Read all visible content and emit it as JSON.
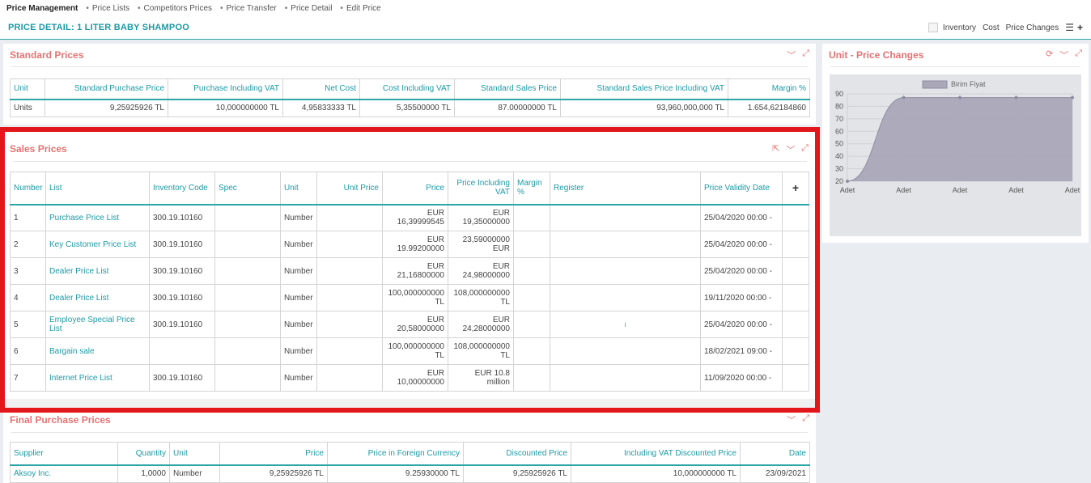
{
  "breadcrumb": {
    "active": "Price Management",
    "items": [
      "Price Lists",
      "Competitors Prices",
      "Price Transfer",
      "Price Detail",
      "Edit Price"
    ]
  },
  "header": {
    "title": "PRICE DETAIL: 1 LITER BABY SHAMPOO",
    "inventory": "Inventory",
    "cost": "Cost",
    "price_changes": "Price Changes"
  },
  "standard": {
    "title": "Standard Prices",
    "columns": [
      "Unit",
      "Standard Purchase Price",
      "Purchase Including VAT",
      "Net Cost",
      "Cost Including VAT",
      "Standard Sales Price",
      "Standard Sales Price Including VAT",
      "Margin %"
    ],
    "row": [
      "Units",
      "9,25925926 TL",
      "10,000000000 TL",
      "4,95833333 TL",
      "5,35500000 TL",
      "87.00000000 TL",
      "93,960,000,000 TL",
      "1.654,62184860"
    ]
  },
  "sales": {
    "title": "Sales Prices",
    "columns": [
      "Number",
      "List",
      "Inventory Code",
      "Spec",
      "Unit",
      "Unit Price",
      "Price",
      "Price Including VAT",
      "Margin %",
      "Register",
      "Price Validity Date"
    ],
    "add": "+",
    "rows": [
      {
        "num": "1",
        "list": "Purchase Price List",
        "code": "300.19.10160",
        "unit": "Number",
        "price1": "EUR",
        "price2": "16,39999545",
        "vat1": "EUR",
        "vat2": "19,35000000",
        "reg": "",
        "date": "25/04/2020 00:00 -"
      },
      {
        "num": "2",
        "list": "Key Customer Price List",
        "code": "300.19.10160",
        "unit": "Number",
        "price1": "EUR",
        "price2": "19.99200000",
        "vat1": "23,59000000",
        "vat2": "EUR",
        "reg": "",
        "date": "25/04/2020 00:00 -"
      },
      {
        "num": "3",
        "list": "Dealer Price List",
        "code": "300.19.10160",
        "unit": "Number",
        "price1": "EUR",
        "price2": "21,16800000",
        "vat1": "EUR",
        "vat2": "24,98000000",
        "reg": "",
        "date": "25/04/2020 00:00 -"
      },
      {
        "num": "4",
        "list": "Dealer Price List",
        "code": "300.19.10160",
        "unit": "Number",
        "price1": "100,000000000",
        "price2": "TL",
        "vat1": "108,000000000",
        "vat2": "TL",
        "reg": "",
        "date": "19/11/2020 00:00 -"
      },
      {
        "num": "5",
        "list": "Employee Special Price List",
        "code": "300.19.10160",
        "unit": "Number",
        "price1": "EUR",
        "price2": "20,58000000",
        "vat1": "EUR",
        "vat2": "24,28000000",
        "reg": "ı",
        "date": "25/04/2020 00:00 -"
      },
      {
        "num": "6",
        "list": "Bargain sale",
        "code": "",
        "unit": "Number",
        "price1": "100,000000000",
        "price2": "TL",
        "vat1": "108,000000000",
        "vat2": "TL",
        "reg": "",
        "date": "18/02/2021 09:00 -"
      },
      {
        "num": "7",
        "list": "Internet Price List",
        "code": "300.19.10160",
        "unit": "Number",
        "price1": "EUR",
        "price2": "10,00000000",
        "vat1": "EUR 10.8 million",
        "vat2": "",
        "reg": "",
        "date": "11/09/2020 00:00 -"
      }
    ]
  },
  "final": {
    "title": "Final Purchase Prices",
    "columns": [
      "Supplier",
      "Quantity",
      "Unit",
      "Price",
      "Price in Foreign Currency",
      "Discounted Price",
      "Including VAT Discounted Price",
      "Date"
    ],
    "row": [
      "Aksoy Inc.",
      "1,0000",
      "Number",
      "9,25925926 TL",
      "9.25930000 TL",
      "9,25925926 TL",
      "10,000000000 TL",
      "23/09/2021"
    ]
  },
  "unit_price_changes": {
    "title": "Unit - Price Changes"
  },
  "chart_data": {
    "type": "area",
    "legend": "Birim Fiyat",
    "legend_position": "top",
    "categories": [
      "Adet",
      "Adet",
      "Adet",
      "Adet",
      "Adet"
    ],
    "series": [
      {
        "name": "Birim Fiyat",
        "values": [
          20,
          87,
          87,
          87,
          87
        ]
      }
    ],
    "ylim": [
      20,
      90
    ],
    "yticks": [
      20,
      30,
      40,
      50,
      60,
      70,
      80,
      90
    ],
    "grid": true,
    "colors": {
      "fill": "#a9a7b8",
      "line": "#8e8ca0"
    }
  }
}
